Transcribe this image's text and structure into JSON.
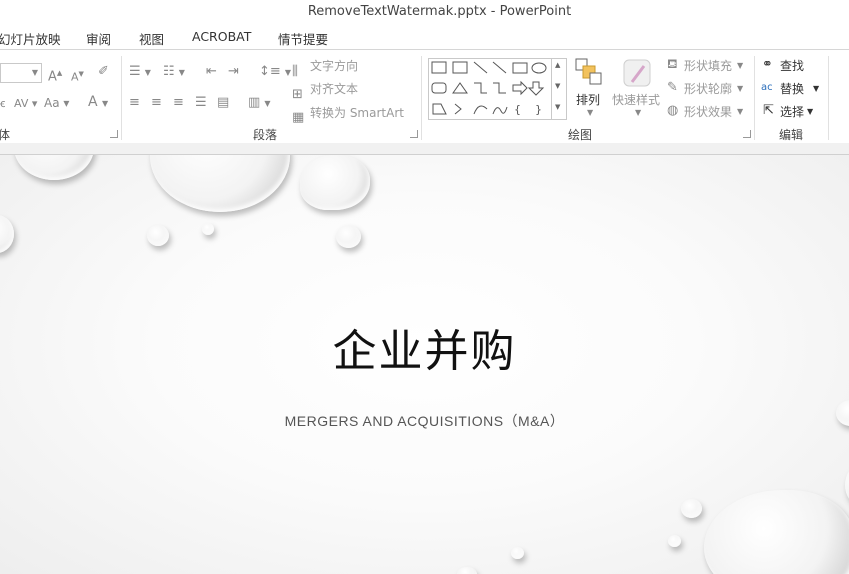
{
  "window": {
    "title": "RemoveTextWatermak.pptx - PowerPoint"
  },
  "tabs": [
    "幻灯片放映",
    "审阅",
    "视图",
    "ACROBAT",
    "情节提要"
  ],
  "ribbon": {
    "font_group": {
      "label": "体"
    },
    "paragraph_group": {
      "label": "段落",
      "text_direction": "文字方向",
      "align_text": "对齐文本",
      "convert_smartart": "转换为 SmartArt"
    },
    "drawing_group": {
      "label": "绘图",
      "arrange": "排列",
      "quick_styles": "快速样式",
      "shape_fill": "形状填充",
      "shape_outline": "形状轮廓",
      "shape_effects": "形状效果"
    },
    "editing_group": {
      "label": "编辑",
      "find": "查找",
      "replace": "替换",
      "select": "选择"
    }
  },
  "slide": {
    "title": "企业并购",
    "subtitle": "MERGERS AND ACQUISITIONS（M&A）"
  }
}
